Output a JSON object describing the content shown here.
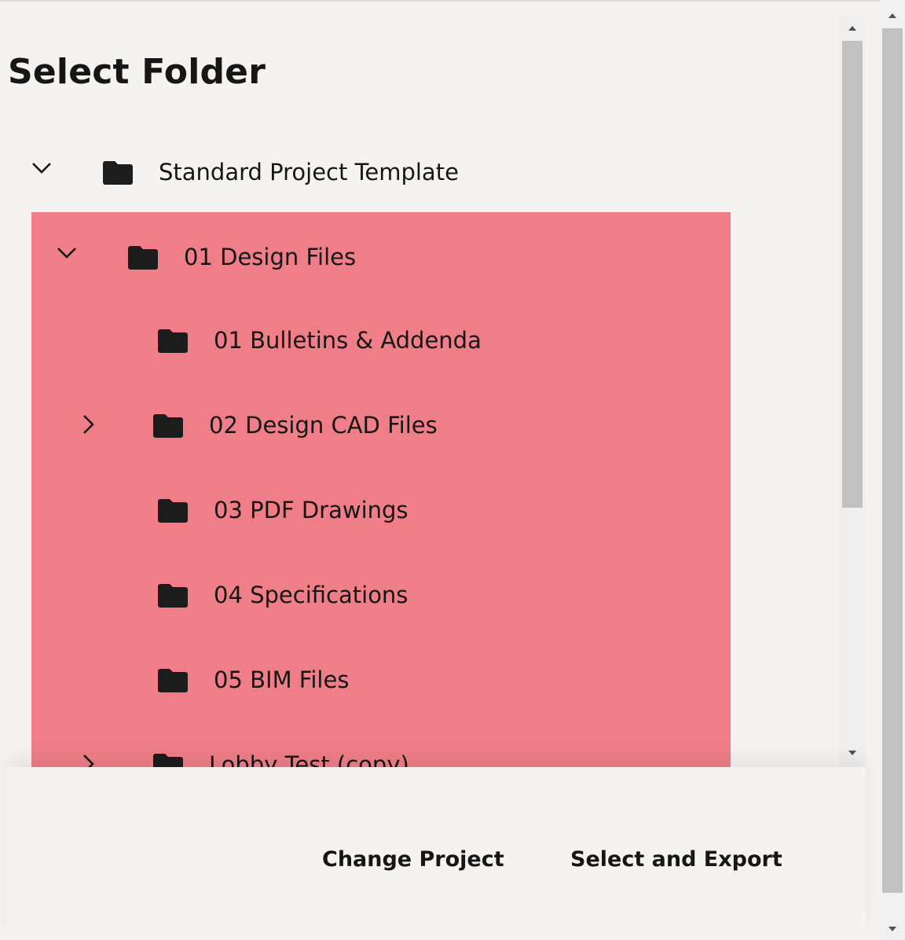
{
  "dialog": {
    "title": "Select Folder"
  },
  "tree": {
    "items": [
      {
        "label": "Standard Project Template",
        "chevron": "chevron-down-icon",
        "icon": "folder-icon"
      },
      {
        "label": "01 Design Files",
        "chevron": "chevron-down-icon",
        "icon": "folder-icon"
      },
      {
        "label": "01 Bulletins & Addenda",
        "chevron": "",
        "icon": "folder-icon"
      },
      {
        "label": "02 Design CAD Files",
        "chevron": "chevron-right-icon",
        "icon": "folder-icon"
      },
      {
        "label": "03 PDF Drawings",
        "chevron": "",
        "icon": "folder-icon"
      },
      {
        "label": "04 Specifications",
        "chevron": "",
        "icon": "folder-icon"
      },
      {
        "label": "05 BIM Files",
        "chevron": "",
        "icon": "folder-icon"
      },
      {
        "label": "Lobby Test (copy)",
        "chevron": "chevron-right-icon",
        "icon": "folder-icon"
      }
    ]
  },
  "footer": {
    "change_project_label": "Change Project",
    "select_export_label": "Select and Export"
  },
  "colors": {
    "highlight": "#ef7e88",
    "background": "#f4f3f2",
    "text": "#161616",
    "scrollbar_thumb": "#c1c1c1"
  }
}
